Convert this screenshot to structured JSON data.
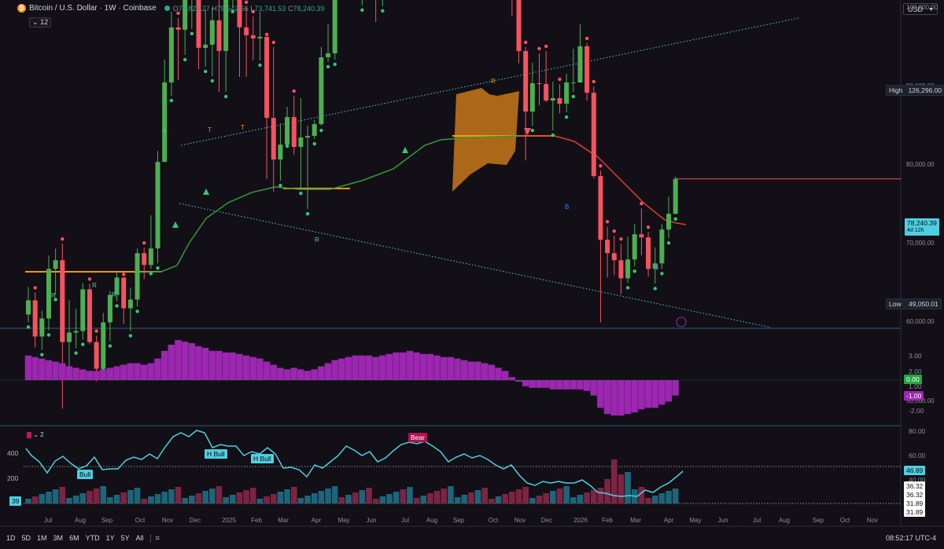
{
  "header": {
    "symbol_title": "Bitcoin / U.S. Dollar · 1W · Coinbase",
    "ohlc": {
      "o_label": "O",
      "o": "73,823.27",
      "h_label": "H",
      "h": "78,542.56",
      "l_label": "L",
      "l": "73,741.53",
      "c_label": "C",
      "c": "78,240.39"
    },
    "indicator_collapse": "12",
    "currency": "USD"
  },
  "price_axis": {
    "labels": [
      "150,000.00",
      "140,000.00",
      "130,000.00",
      "120,000.00",
      "110,000.00",
      "100,000.00",
      "90,000.00",
      "80,000.00",
      "70,000.00",
      "60,000.00",
      "50,000.00"
    ],
    "high_label": "High",
    "high_value": "126,296.00",
    "low_label": "Low",
    "low_value": "49,050.01",
    "current_price": "78,240.39",
    "countdown": "4d 12h"
  },
  "macd_axis": {
    "labels": [
      "3.00",
      "2.00",
      "1.00",
      "-2.00"
    ],
    "zero_tag": "0.00",
    "hist_tag": "-1.00"
  },
  "rsi_panel": {
    "legend_value": "2",
    "axis_labels": [
      "80.00",
      "60.00",
      "40.00"
    ],
    "value_tags": [
      "46.89",
      "36.32",
      "36.32",
      "31.89",
      "31.89"
    ],
    "vol_labels": [
      "400",
      "200"
    ],
    "vol_tag": "39",
    "annotations": [
      "Bull",
      "H Bull",
      "H Bull",
      "Bear"
    ]
  },
  "chart_markers": {
    "T": [
      "T",
      "T"
    ],
    "R_bottom": [
      "R",
      "R",
      "R",
      "R"
    ],
    "R_top": "R",
    "B": [
      "B",
      "B"
    ]
  },
  "time_axis": [
    "Jul",
    "Aug",
    "Sep",
    "Oct",
    "Nov",
    "Dec",
    "2025",
    "Feb",
    "Mar",
    "Apr",
    "May",
    "Jun",
    "Jul",
    "Aug",
    "Sep",
    "Oct",
    "Nov",
    "Dec",
    "2026",
    "Feb",
    "Mar",
    "Apr",
    "May",
    "Jun",
    "Jul",
    "Aug",
    "Sep",
    "Oct",
    "Nov"
  ],
  "timeframes": [
    "1D",
    "5D",
    "1M",
    "3M",
    "6M",
    "YTD",
    "1Y",
    "5Y",
    "All"
  ],
  "clock": "08:52:17 UTC-4",
  "colors": {
    "bg": "#130f17",
    "up": "#4caf50",
    "down": "#f7525f",
    "macd": "#9c27b0",
    "rsi": "#4dd0e1",
    "accent": "#f7931a"
  },
  "chart_data": {
    "type": "candlestick",
    "interval": "1W",
    "ylim": [
      45000,
      155000
    ],
    "dates": [
      "2024-06-24",
      "2024-07-01",
      "2024-07-08",
      "2024-07-15",
      "2024-07-22",
      "2024-07-29",
      "2024-08-05",
      "2024-08-12",
      "2024-08-19",
      "2024-08-26",
      "2024-09-02",
      "2024-09-09",
      "2024-09-16",
      "2024-09-23",
      "2024-09-30",
      "2024-10-07",
      "2024-10-14",
      "2024-10-21",
      "2024-10-28",
      "2024-11-04",
      "2024-11-11",
      "2024-11-18",
      "2024-11-25",
      "2024-12-02",
      "2024-12-09",
      "2024-12-16",
      "2024-12-23",
      "2024-12-30",
      "2025-01-06",
      "2025-01-13",
      "2025-01-20",
      "2025-01-27",
      "2025-02-03",
      "2025-02-10",
      "2025-02-17",
      "2025-02-24",
      "2025-03-03",
      "2025-03-10",
      "2025-03-17",
      "2025-03-24",
      "2025-03-31",
      "2025-04-07",
      "2025-04-14",
      "2025-04-21",
      "2025-04-28",
      "2025-05-05",
      "2025-05-12",
      "2025-05-19",
      "2025-05-26",
      "2025-06-02",
      "2025-06-09",
      "2025-06-16",
      "2025-06-23",
      "2025-06-30",
      "2025-07-07",
      "2025-07-14",
      "2025-07-21",
      "2025-07-28",
      "2025-08-04",
      "2025-08-11",
      "2025-08-18",
      "2025-08-25",
      "2025-09-01",
      "2025-09-08",
      "2025-09-15",
      "2025-09-22",
      "2025-09-29",
      "2025-10-06",
      "2025-10-13",
      "2025-10-20",
      "2025-10-27",
      "2025-11-03",
      "2025-11-10",
      "2025-11-17",
      "2025-11-24",
      "2025-12-01",
      "2025-12-08",
      "2025-12-15",
      "2025-12-22",
      "2025-12-29",
      "2026-01-05",
      "2026-01-12",
      "2026-01-19",
      "2026-01-26",
      "2026-02-02",
      "2026-02-09",
      "2026-02-16",
      "2026-02-23",
      "2026-03-02",
      "2026-03-09",
      "2026-03-16",
      "2026-03-23",
      "2026-03-30",
      "2026-04-06",
      "2026-04-13",
      "2026-04-20"
    ],
    "close": [
      62800,
      58200,
      60500,
      66800,
      67900,
      57500,
      58700,
      58900,
      64200,
      57500,
      54100,
      60000,
      63500,
      65700,
      61800,
      62900,
      68800,
      67300,
      69400,
      80400,
      90500,
      97500,
      97200,
      101400,
      104500,
      94900,
      95300,
      98400,
      94500,
      104600,
      104800,
      97500,
      96500,
      96100,
      96300,
      86000,
      80700,
      82600,
      86100,
      82300,
      83500,
      83700,
      85200,
      93700,
      94200,
      104700,
      103100,
      108900,
      105600,
      105700,
      105600,
      101500,
      108400,
      109200,
      119000,
      117200,
      119500,
      114200,
      119300,
      117500,
      113500,
      108300,
      111100,
      115300,
      115300,
      112200,
      123500,
      115100,
      108700,
      114500,
      110600,
      104700,
      94500,
      86800,
      90400,
      90300,
      88200,
      88500,
      87800,
      90500,
      90500,
      95100,
      89200,
      78600,
      70500,
      68800,
      67900,
      65600,
      68000,
      71200,
      70800,
      66800,
      67500,
      71800,
      73800,
      78240
    ],
    "high": [
      64500,
      63800,
      61500,
      68500,
      69400,
      70000,
      62800,
      61700,
      65000,
      64900,
      58300,
      61200,
      64000,
      66500,
      65500,
      64400,
      69400,
      69500,
      73600,
      81800,
      93400,
      99500,
      98700,
      104100,
      108300,
      107800,
      99800,
      100000,
      102700,
      106000,
      109400,
      102500,
      100100,
      98900,
      99500,
      96000,
      95000,
      85300,
      87400,
      88800,
      88500,
      85000,
      85700,
      95000,
      97900,
      104800,
      106300,
      111900,
      110800,
      106800,
      110400,
      108000,
      108500,
      110500,
      119400,
      123200,
      120000,
      119500,
      124400,
      124500,
      117400,
      113500,
      112900,
      116800,
      117900,
      114400,
      125600,
      126296,
      115900,
      116400,
      116100,
      107500,
      106000,
      95000,
      93000,
      94200,
      94500,
      90600,
      90300,
      91600,
      94800,
      97900,
      95500,
      90000,
      79300,
      72200,
      71000,
      70000,
      70900,
      72500,
      74500,
      71500,
      69500,
      72500,
      76000,
      78542
    ],
    "low": [
      60000,
      56800,
      56500,
      59000,
      63500,
      49050,
      54000,
      56700,
      57800,
      57200,
      52500,
      54500,
      57600,
      62700,
      59800,
      58900,
      62000,
      65500,
      66800,
      67500,
      85000,
      88800,
      90800,
      94000,
      97300,
      92200,
      92500,
      91300,
      89300,
      89300,
      100100,
      91200,
      91200,
      93300,
      93300,
      78200,
      76600,
      78000,
      83000,
      81300,
      77000,
      74400,
      83300,
      85000,
      93100,
      93400,
      101300,
      102200,
      103100,
      100300,
      102700,
      98200,
      100200,
      105000,
      108300,
      116000,
      114900,
      112000,
      112800,
      116500,
      112000,
      107400,
      107300,
      110900,
      114600,
      108600,
      111800,
      103000,
      106500,
      107400,
      106300,
      98900,
      92900,
      80600,
      85000,
      87600,
      88000,
      84400,
      86600,
      86700,
      89300,
      91300,
      88200,
      78300,
      60000,
      65700,
      66000,
      63600,
      65000,
      67100,
      68500,
      65800,
      64900,
      66800,
      70700,
      73741
    ]
  }
}
